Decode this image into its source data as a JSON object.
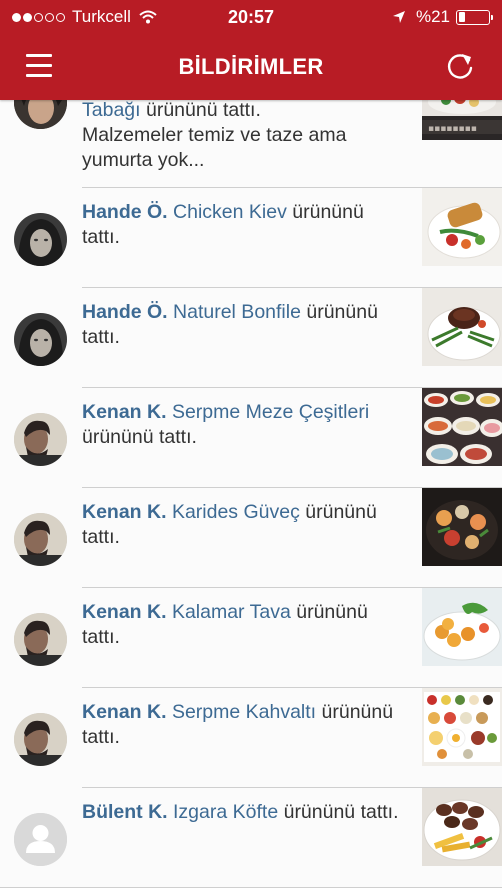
{
  "status_bar": {
    "carrier": "Turkcell",
    "time": "20:57",
    "battery": "%21",
    "battery_level": 0.21
  },
  "nav": {
    "title": "BİLDİRİMLER"
  },
  "partial_item": {
    "product_tail": "Tabağı",
    "suffix": " ürününü tattı.",
    "comment": "Malzemeler temiz ve taze ama yumurta yok..."
  },
  "notifications": [
    {
      "user": "Hande Ö.",
      "product": "Chicken Kiev",
      "action": "ürününü tattı."
    },
    {
      "user": "Hande Ö.",
      "product": "Naturel Bonfile",
      "action": "ürününü tattı."
    },
    {
      "user": "Kenan K.",
      "product": "Serpme Meze Çeşitleri",
      "action": "ürününü tattı."
    },
    {
      "user": "Kenan K.",
      "product": "Karides Güveç",
      "action": "ürününü tattı."
    },
    {
      "user": "Kenan K.",
      "product": "Kalamar Tava",
      "action": "ürününü tattı."
    },
    {
      "user": "Kenan K.",
      "product": "Serpme Kahvaltı",
      "action": "ürününü tattı."
    },
    {
      "user": "Bülent K.",
      "product": "Izgara Köfte",
      "action": "ürününü tattı."
    }
  ],
  "colors": {
    "brand_red": "#b81c25",
    "link_blue": "#3d6a93",
    "text": "#333333"
  }
}
